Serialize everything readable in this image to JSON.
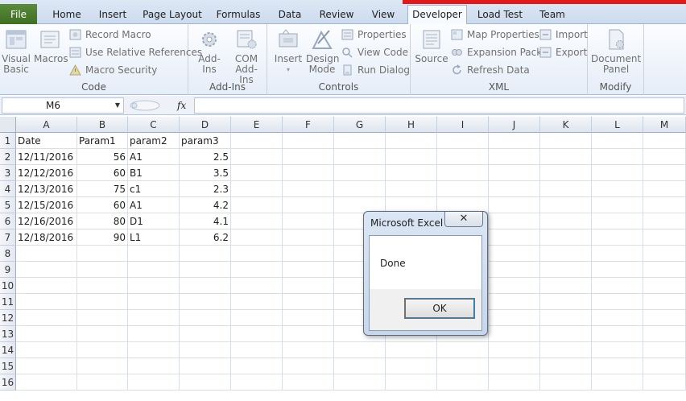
{
  "ribbon_tabs": {
    "file": "File",
    "home": "Home",
    "insert": "Insert",
    "page_layout": "Page Layout",
    "formulas": "Formulas",
    "data": "Data",
    "review": "Review",
    "view": "View",
    "developer": "Developer",
    "load_test": "Load Test",
    "team": "Team"
  },
  "groups": {
    "code": {
      "label": "Code",
      "visual_basic": "Visual Basic",
      "macros": "Macros",
      "record_macro": "Record Macro",
      "relative_refs": "Use Relative References",
      "macro_security": "Macro Security"
    },
    "addins": {
      "label": "Add-Ins",
      "addins": "Add-Ins",
      "com_addins": "COM Add-Ins"
    },
    "controls": {
      "label": "Controls",
      "insert": "Insert",
      "design_mode": "Design Mode",
      "properties": "Properties",
      "view_code": "View Code",
      "run_dialog": "Run Dialog"
    },
    "xml": {
      "label": "XML",
      "source": "Source",
      "map_properties": "Map Properties",
      "expansion_packs": "Expansion Packs",
      "refresh_data": "Refresh Data",
      "import": "Import",
      "export": "Export"
    },
    "modify": {
      "label": "Modify",
      "document_panel": "Document Panel"
    }
  },
  "formula_bar": {
    "name_box": "M6",
    "fx": "fx",
    "value": ""
  },
  "columns": [
    "A",
    "B",
    "C",
    "D",
    "E",
    "F",
    "G",
    "H",
    "I",
    "J",
    "K",
    "L",
    "M"
  ],
  "rows": [
    "1",
    "2",
    "3",
    "4",
    "5",
    "6",
    "7",
    "8",
    "9",
    "10",
    "11",
    "12",
    "13",
    "14",
    "15",
    "16"
  ],
  "cells": {
    "header": [
      "Date",
      "Param1",
      "param2",
      "param3"
    ],
    "data": [
      [
        "12/11/2016",
        "56",
        "A1",
        "2.5"
      ],
      [
        "12/12/2016",
        "60",
        "B1",
        "3.5"
      ],
      [
        "12/13/2016",
        "75",
        "c1",
        "2.3"
      ],
      [
        "12/15/2016",
        "60",
        "A1",
        "4.2"
      ],
      [
        "12/16/2016",
        "80",
        "D1",
        "4.1"
      ],
      [
        "12/18/2016",
        "90",
        "L1",
        "6.2"
      ]
    ]
  },
  "dialog": {
    "title": "Microsoft Excel",
    "close": "✕",
    "message": "Done",
    "ok": "OK"
  },
  "colors": {
    "file_tab": "#3d6e22",
    "accent_red": "#e01a1a",
    "ribbon_bg": "#e5edf8"
  }
}
